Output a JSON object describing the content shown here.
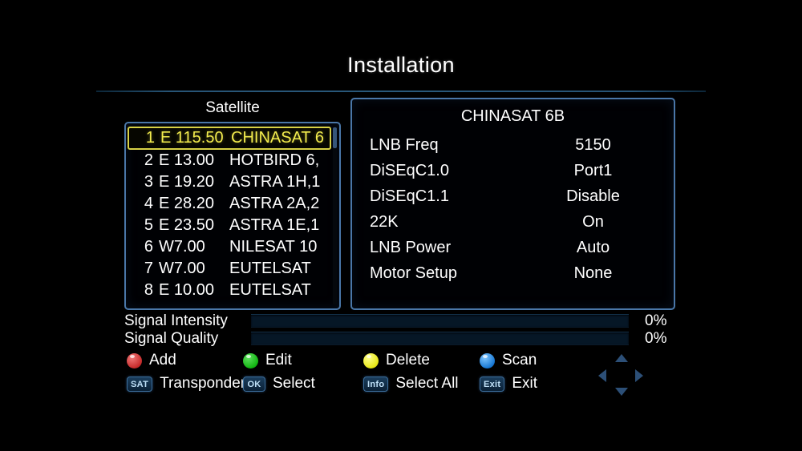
{
  "screen": {
    "title": "Installation",
    "background": "#000000",
    "panel_border": "#4a77a8",
    "highlight_color": "#f3ec4e"
  },
  "satellite_section": {
    "header": "Satellite",
    "selected_index": 0,
    "items": [
      {
        "num": "1",
        "position": "E 115.50",
        "name": "CHINASAT 6"
      },
      {
        "num": "2",
        "position": "E 13.00",
        "name": "HOTBIRD 6,"
      },
      {
        "num": "3",
        "position": "E 19.20",
        "name": "ASTRA 1H,1"
      },
      {
        "num": "4",
        "position": "E 28.20",
        "name": "ASTRA 2A,2"
      },
      {
        "num": "5",
        "position": "E 23.50",
        "name": "ASTRA 1E,1"
      },
      {
        "num": "6",
        "position": "W7.00",
        "name": "NILESAT 10"
      },
      {
        "num": "7",
        "position": "W7.00",
        "name": "EUTELSAT"
      },
      {
        "num": "8",
        "position": "E 10.00",
        "name": "EUTELSAT"
      }
    ]
  },
  "detail_section": {
    "title": "CHINASAT 6B",
    "rows": [
      {
        "label": "LNB Freq",
        "value": "5150"
      },
      {
        "label": "DiSEqC1.0",
        "value": "Port1"
      },
      {
        "label": "DiSEqC1.1",
        "value": "Disable"
      },
      {
        "label": "22K",
        "value": "On"
      },
      {
        "label": "LNB Power",
        "value": "Auto"
      },
      {
        "label": "Motor Setup",
        "value": "None"
      }
    ]
  },
  "signal": {
    "intensity": {
      "label": "Signal Intensity",
      "percent": "0%",
      "value": 0
    },
    "quality": {
      "label": "Signal Quality",
      "percent": "0%",
      "value": 0
    }
  },
  "legend": {
    "color_keys": [
      {
        "color": "red",
        "hex": "#c62b2b",
        "label": "Add"
      },
      {
        "color": "green",
        "hex": "#12b512",
        "label": "Edit"
      },
      {
        "color": "yellow",
        "hex": "#e8e817",
        "label": "Delete"
      },
      {
        "color": "blue",
        "hex": "#1878d4",
        "label": "Scan"
      }
    ],
    "button_keys": [
      {
        "key": "SAT",
        "label": "Transponder"
      },
      {
        "key": "OK",
        "label": "Select"
      },
      {
        "key": "Info",
        "label": "Select All"
      },
      {
        "key": "Exit",
        "label": "Exit"
      }
    ]
  },
  "dpad": {
    "up": "up-arrow",
    "down": "down-arrow",
    "left": "left-arrow",
    "right": "right-arrow"
  }
}
